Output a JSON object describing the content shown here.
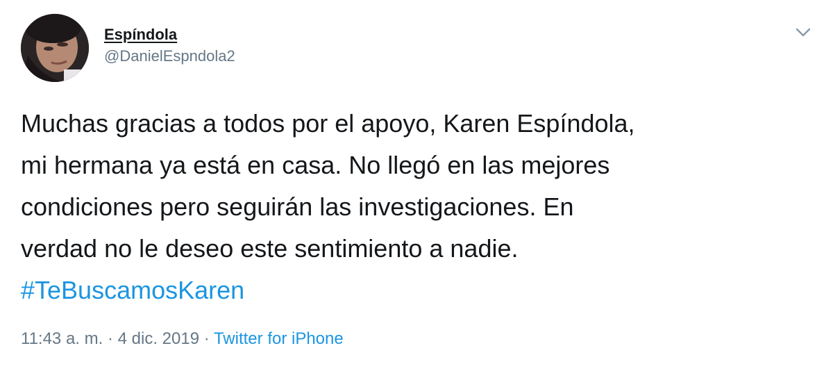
{
  "author": {
    "display_name": "Espíndola",
    "handle": "@DanielEspndola2"
  },
  "tweet": {
    "lines": [
      "Muchas gracias a todos por el apoyo, Karen Espíndola,",
      "mi hermana ya está en casa. No llegó en las mejores",
      "condiciones pero seguirán las investigaciones. En",
      "verdad no le deseo este sentimiento a nadie."
    ],
    "hashtag": "#TeBuscamosKaren"
  },
  "meta": {
    "time": "11:43 a. m.",
    "separator": "·",
    "date": "4 dic. 2019",
    "source": "Twitter for iPhone"
  },
  "icons": {
    "menu": "chevron-down-icon",
    "avatar": "profile-photo"
  },
  "colors": {
    "text": "#14171a",
    "secondary": "#657786",
    "link": "#1b95e0"
  }
}
